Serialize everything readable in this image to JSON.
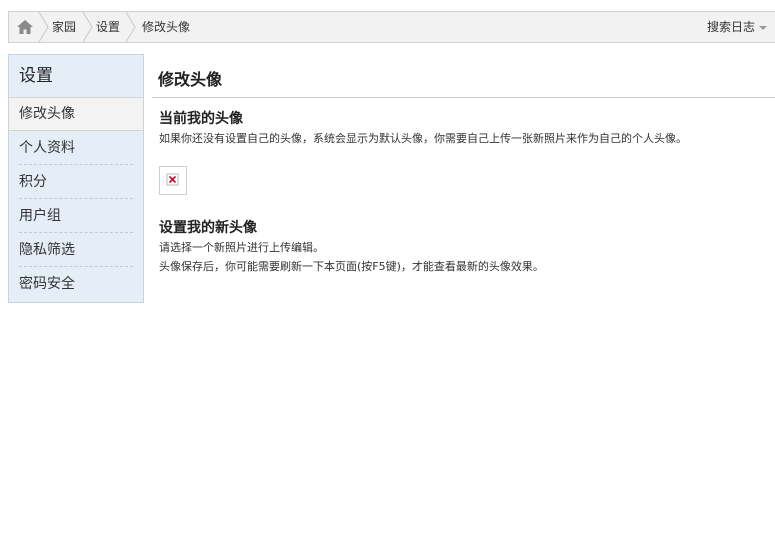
{
  "breadcrumb": {
    "items": [
      "家园",
      "设置",
      "修改头像"
    ],
    "right_menu": "搜索日志"
  },
  "sidebar": {
    "title": "设置",
    "items": [
      {
        "label": "修改头像",
        "active": true
      },
      {
        "label": "个人资料",
        "active": false
      },
      {
        "label": "积分",
        "active": false
      },
      {
        "label": "用户组",
        "active": false
      },
      {
        "label": "隐私筛选",
        "active": false
      },
      {
        "label": "密码安全",
        "active": false
      }
    ]
  },
  "main": {
    "title": "修改头像",
    "current": {
      "heading": "当前我的头像",
      "text": "如果你还没有设置自己的头像，系统会显示为默认头像，你需要自己上传一张新照片来作为自己的个人头像。"
    },
    "new": {
      "heading": "设置我的新头像",
      "line1": "请选择一个新照片进行上传编辑。",
      "line2": "头像保存后，你可能需要刷新一下本页面(按F5键)，才能查看最新的头像效果。"
    }
  },
  "colors": {
    "sidebar_bg": "#e5eef7",
    "crumb_bg": "#f2f2f2",
    "broken_image_x": "#c8102e"
  },
  "icons": {
    "home": "home-icon",
    "dropdown": "caret-down-icon",
    "avatar": "broken-image-icon"
  }
}
